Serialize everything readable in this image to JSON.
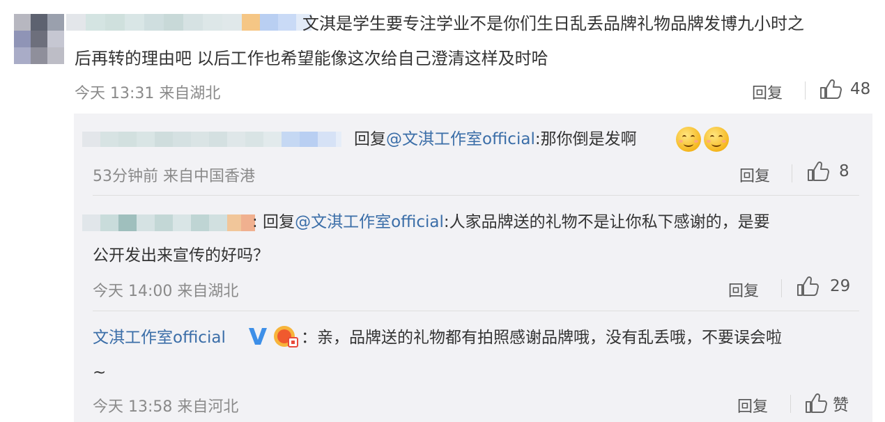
{
  "comment": {
    "text_line1": "文淇是学生要专注学业不是你们生日乱丢品牌礼物品牌发博九小时之",
    "text_line2": "后再转的理由吧 以后工作也希望能像这次给自己澄清这样及时哈",
    "meta": "今天 13:31 来自湖北",
    "reply_label": "回复",
    "likes": "48"
  },
  "replies": [
    {
      "prefix": "回复",
      "mention": "@文淇工作室official",
      "text": ":那你倒是发啊",
      "emoji": "smiling-emoji",
      "meta": "53分钟前 来自中国香港",
      "reply_label": "回复",
      "likes": "8"
    },
    {
      "colon": ":",
      "prefix": " 回复",
      "mention": "@文淇工作室official",
      "text_line1": ":人家品牌送的礼物不是让你私下感谢的，是要",
      "text_line2": "公开发出来宣传的好吗？",
      "meta": "今天 14:00 来自湖北",
      "reply_label": "回复",
      "likes": "29"
    },
    {
      "author": "文淇工作室official",
      "text_line1": "：亲，品牌送的礼物都有拍照感谢品牌哦，没有乱丢哦，不要误会啦",
      "text_line2": "~",
      "meta": "今天 13:58 来自河北",
      "reply_label": "回复",
      "likes": "赞"
    }
  ],
  "colors": {
    "link": "#3b6ea8",
    "panel_bg": "#f2f2f5",
    "meta_text": "#8a8a8a",
    "verified_v": "#3d8fe8"
  }
}
